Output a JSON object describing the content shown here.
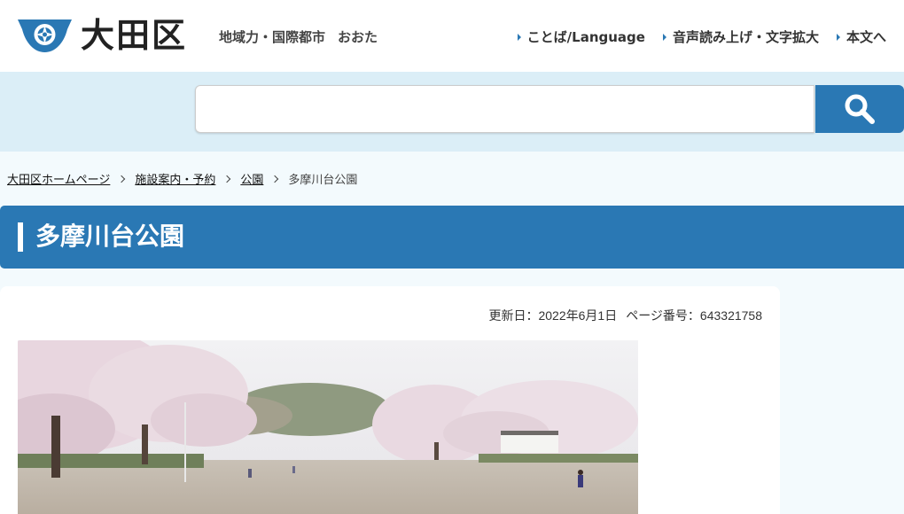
{
  "header": {
    "logo_text": "大田区",
    "tagline": [
      "地域力・国際都市",
      "おおた"
    ],
    "utility_links": [
      {
        "label": "ことば/Language"
      },
      {
        "label": "音声読み上げ・文字拡大"
      },
      {
        "label": "本文へ"
      }
    ]
  },
  "search": {
    "placeholder": "",
    "button_icon": "search-icon"
  },
  "breadcrumb": {
    "items": [
      "大田区ホームページ",
      "施設案内・予約",
      "公園"
    ],
    "current": "多摩川台公園"
  },
  "page": {
    "title": "多摩川台公園",
    "updated": "更新日：2022年6月1日",
    "page_number": "ページ番号：643321758"
  },
  "colors": {
    "accent": "#2a78b4",
    "band": "#dbeef7",
    "background": "#f3fafd"
  }
}
